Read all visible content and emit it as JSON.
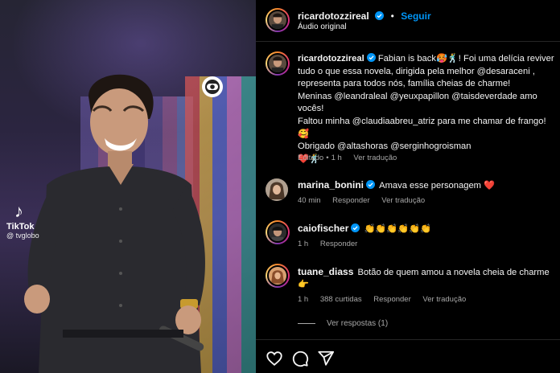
{
  "video": {
    "tiktok_label": "TikTok",
    "tiktok_handle": "@ tvglobo",
    "icons": [
      "globo-logo-icon",
      "tiktok-icon"
    ]
  },
  "header": {
    "username": "ricardotozzireal",
    "separator": "•",
    "follow_label": "Seguir",
    "audio": "Áudio original"
  },
  "caption": {
    "username": "ricardotozzireal",
    "lines": [
      "Fabian is back🥵🕺! Foi uma delícia reviver",
      "tudo o que essa novela, dirigida pela melhor @desaraceni ,",
      "representa para todos nós, família cheias de charme!",
      "Meninas @leandraleal @yeuxpapillon @taisdeverdade amo",
      "vocês!",
      "Faltou minha @claudiaabreu_atriz para me chamar de frango!🥰",
      "Obrigado @altashoras @serginhogroisman",
      "❤️🕺"
    ],
    "edited": "Editado",
    "time": "1 h",
    "translate": "Ver tradução"
  },
  "comments": [
    {
      "username": "marina_bonini",
      "verified": true,
      "text": "Amava esse personagem ❤️",
      "time": "40 min",
      "reply": "Responder",
      "translate": "Ver tradução",
      "likes": ""
    },
    {
      "username": "caiofischer",
      "verified": true,
      "text": "👏👏👏👏👏👏",
      "time": "1 h",
      "reply": "Responder",
      "translate": "",
      "likes": ""
    },
    {
      "username": "tuane_diass",
      "verified": false,
      "text": "Botão de quem amou a novela cheia de charme",
      "text2": "👉",
      "time": "1 h",
      "likes": "388 curtidas",
      "reply": "Responder",
      "translate": "Ver tradução"
    }
  ],
  "view_replies": "Ver respostas (1)",
  "actions": [
    "heart-icon",
    "comment-icon",
    "share-icon"
  ],
  "colors": {
    "background": "#000000",
    "text": "#f5f5f5",
    "muted": "#a8a8a8",
    "accent": "#0095f6",
    "heart": "#ed4956"
  }
}
